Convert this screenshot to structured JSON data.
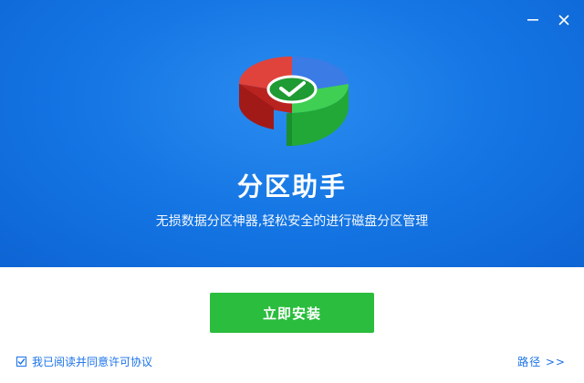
{
  "window": {
    "controls": [
      {
        "name": "minimize",
        "icon": "minimize-icon"
      },
      {
        "name": "close",
        "icon": "close-icon"
      }
    ]
  },
  "hero": {
    "logo_icon": "partition-pie-check-icon",
    "title": "分区助手",
    "subtitle": "无损数据分区神器,轻松安全的进行磁盘分区管理",
    "colors": {
      "background": "#1475e3",
      "text": "#ffffff"
    }
  },
  "actions": {
    "install_label": "立即安装",
    "install_color": "#2bbd3e"
  },
  "footer": {
    "agreement_checked": true,
    "agreement_text": "我已阅读并同意许可协议",
    "path_label": "路径 >>",
    "link_color": "#1a73e8"
  }
}
